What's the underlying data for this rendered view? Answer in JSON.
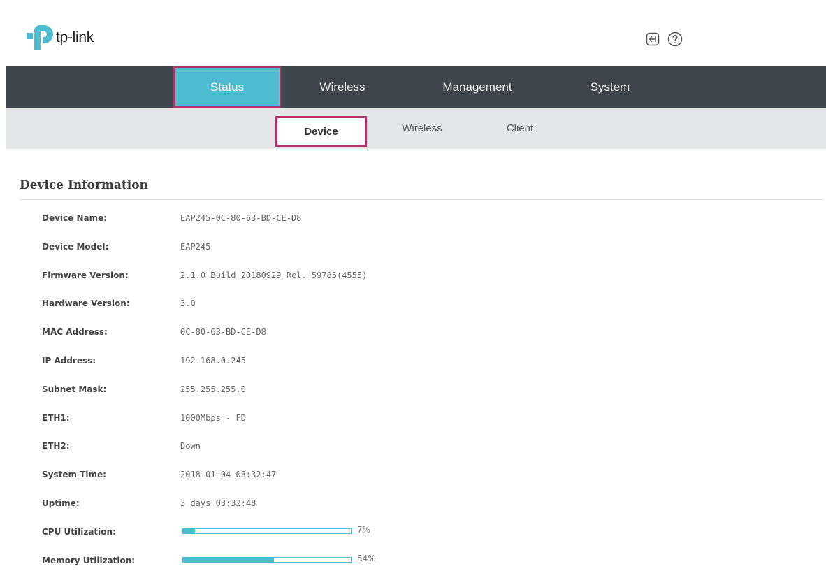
{
  "header": {
    "logo_text": "tp-link",
    "brand_color": "#4dbbd0",
    "icons": [
      "logout-icon",
      "help-icon"
    ]
  },
  "main_nav": {
    "tabs": [
      {
        "label": "Status",
        "active": true
      },
      {
        "label": "Wireless",
        "active": false
      },
      {
        "label": "Management",
        "active": false
      },
      {
        "label": "System",
        "active": false
      }
    ]
  },
  "sub_nav": {
    "tabs": [
      {
        "label": "Device",
        "active": true
      },
      {
        "label": "Wireless",
        "active": false
      },
      {
        "label": "Client",
        "active": false
      }
    ]
  },
  "device_info": {
    "title": "Device Information",
    "fields": [
      {
        "label": "Device Name:",
        "value": "EAP245-0C-80-63-BD-CE-D8"
      },
      {
        "label": "Device Model:",
        "value": "EAP245"
      },
      {
        "label": "Firmware Version:",
        "value": "2.1.0 Build 20180929 Rel. 59785(4555)"
      },
      {
        "label": "Hardware Version:",
        "value": "3.0"
      },
      {
        "label": "MAC Address:",
        "value": "0C-80-63-BD-CE-D8"
      },
      {
        "label": "IP Address:",
        "value": "192.168.0.245"
      },
      {
        "label": "Subnet Mask:",
        "value": "255.255.255.0"
      },
      {
        "label": "ETH1:",
        "value": "1000Mbps - FD"
      },
      {
        "label": "ETH2:",
        "value": "Down"
      },
      {
        "label": "System Time:",
        "value": "2018-01-04 03:32:47"
      },
      {
        "label": "Uptime:",
        "value": "3 days 03:32:48"
      }
    ],
    "utilization": [
      {
        "label": "CPU Utilization:",
        "percent": 7,
        "value_text": "7%"
      },
      {
        "label": "Memory Utilization:",
        "percent": 54,
        "value_text": "54%"
      }
    ]
  }
}
